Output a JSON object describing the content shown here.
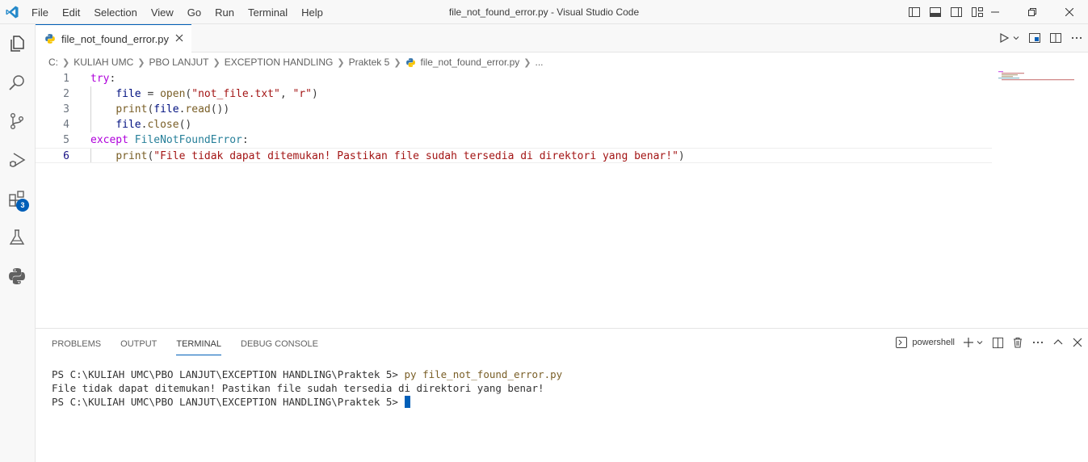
{
  "titlebar": {
    "menus": [
      "File",
      "Edit",
      "Selection",
      "View",
      "Go",
      "Run",
      "Terminal",
      "Help"
    ],
    "title": "file_not_found_error.py - Visual Studio Code"
  },
  "activity": {
    "extensions_badge": "3"
  },
  "tab": {
    "label": "file_not_found_error.py"
  },
  "breadcrumb": [
    "C:",
    "KULIAH UMC",
    "PBO LANJUT",
    "EXCEPTION HANDLING",
    "Praktek 5",
    "file_not_found_error.py",
    "..."
  ],
  "editor": {
    "lines": [
      {
        "num": "1",
        "tokens": [
          {
            "t": "try",
            "c": "kw"
          },
          {
            "t": ":",
            "c": ""
          }
        ]
      },
      {
        "num": "2",
        "tokens": [
          {
            "t": "    ",
            "c": ""
          },
          {
            "t": "file",
            "c": "var"
          },
          {
            "t": " = ",
            "c": ""
          },
          {
            "t": "open",
            "c": "fn"
          },
          {
            "t": "(",
            "c": ""
          },
          {
            "t": "\"not_file.txt\"",
            "c": "str"
          },
          {
            "t": ", ",
            "c": ""
          },
          {
            "t": "\"r\"",
            "c": "str"
          },
          {
            "t": ")",
            "c": ""
          }
        ]
      },
      {
        "num": "3",
        "tokens": [
          {
            "t": "    ",
            "c": ""
          },
          {
            "t": "print",
            "c": "fn"
          },
          {
            "t": "(",
            "c": ""
          },
          {
            "t": "file",
            "c": "var"
          },
          {
            "t": ".",
            "c": ""
          },
          {
            "t": "read",
            "c": "fn"
          },
          {
            "t": "())",
            "c": ""
          }
        ]
      },
      {
        "num": "4",
        "tokens": [
          {
            "t": "    ",
            "c": ""
          },
          {
            "t": "file",
            "c": "var"
          },
          {
            "t": ".",
            "c": ""
          },
          {
            "t": "close",
            "c": "fn"
          },
          {
            "t": "()",
            "c": ""
          }
        ]
      },
      {
        "num": "5",
        "tokens": [
          {
            "t": "except",
            "c": "kw"
          },
          {
            "t": " ",
            "c": ""
          },
          {
            "t": "FileNotFoundError",
            "c": "cls"
          },
          {
            "t": ":",
            "c": ""
          }
        ]
      },
      {
        "num": "6",
        "tokens": [
          {
            "t": "    ",
            "c": ""
          },
          {
            "t": "print",
            "c": "fn"
          },
          {
            "t": "(",
            "c": ""
          },
          {
            "t": "\"File tidak dapat ditemukan! Pastikan file sudah tersedia di direktori yang benar!\"",
            "c": "str"
          },
          {
            "t": ")",
            "c": ""
          }
        ]
      }
    ],
    "active_line": "6"
  },
  "panel": {
    "tabs": [
      "PROBLEMS",
      "OUTPUT",
      "TERMINAL",
      "DEBUG CONSOLE"
    ],
    "active_tab": "TERMINAL",
    "shell": "powershell"
  },
  "terminal": {
    "prompt1": "PS C:\\KULIAH UMC\\PBO LANJUT\\EXCEPTION HANDLING\\Praktek 5> ",
    "cmd1": "py file_not_found_error.py",
    "output1": "File tidak dapat ditemukan! Pastikan file sudah tersedia di direktori yang benar!",
    "prompt2": "PS C:\\KULIAH UMC\\PBO LANJUT\\EXCEPTION HANDLING\\Praktek 5> "
  },
  "colors": {
    "accent": "#005fb8",
    "keyword": "#af00db",
    "string": "#a31515",
    "function": "#795e26",
    "class": "#267f99"
  }
}
